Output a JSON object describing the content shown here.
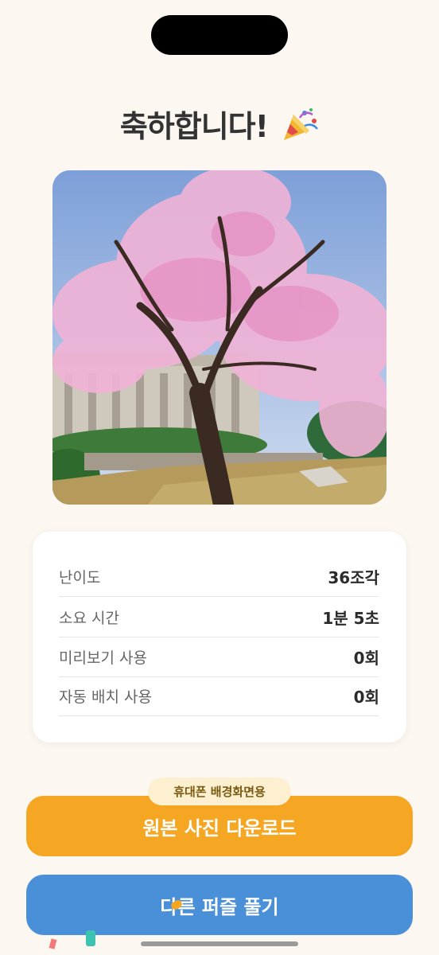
{
  "header": {
    "title": "축하합니다!",
    "title_icon": "party-popper-icon"
  },
  "stats": [
    {
      "label": "난이도",
      "value": "36조각"
    },
    {
      "label": "소요 시간",
      "value": "1분 5초"
    },
    {
      "label": "미리보기 사용",
      "value": "0회"
    },
    {
      "label": "자동 배치 사용",
      "value": "0회"
    }
  ],
  "download": {
    "badge": "휴대폰 배경화면용",
    "label": "원본 사진 다운로드"
  },
  "another": {
    "label": "다른 퍼즐 풀기"
  },
  "colors": {
    "background": "#fdf7f1",
    "download_button": "#f5a623",
    "another_button": "#4a90d9"
  }
}
